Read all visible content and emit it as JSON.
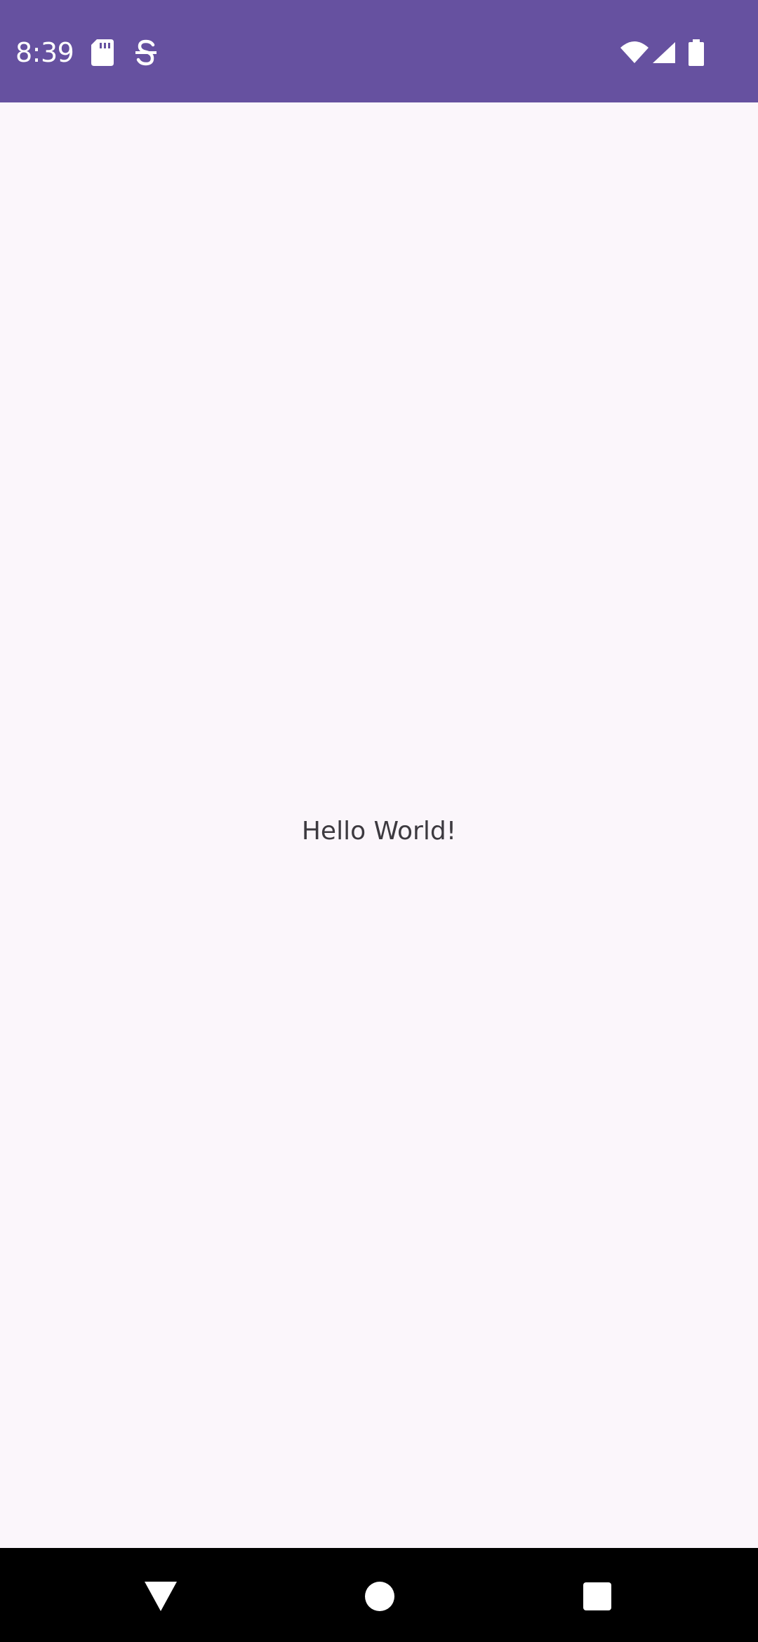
{
  "status_bar": {
    "time": "8:39",
    "icons": [
      "sd-card-icon",
      "s-notification-icon",
      "wifi-icon",
      "cell-signal-icon",
      "battery-icon"
    ],
    "background_color": "#6651a0"
  },
  "main": {
    "text": "Hello World!",
    "background_color": "#fbf6fb",
    "text_color": "#3d3a40"
  },
  "nav_bar": {
    "buttons": [
      "back-icon",
      "home-icon",
      "recents-icon"
    ],
    "background_color": "#000000"
  }
}
